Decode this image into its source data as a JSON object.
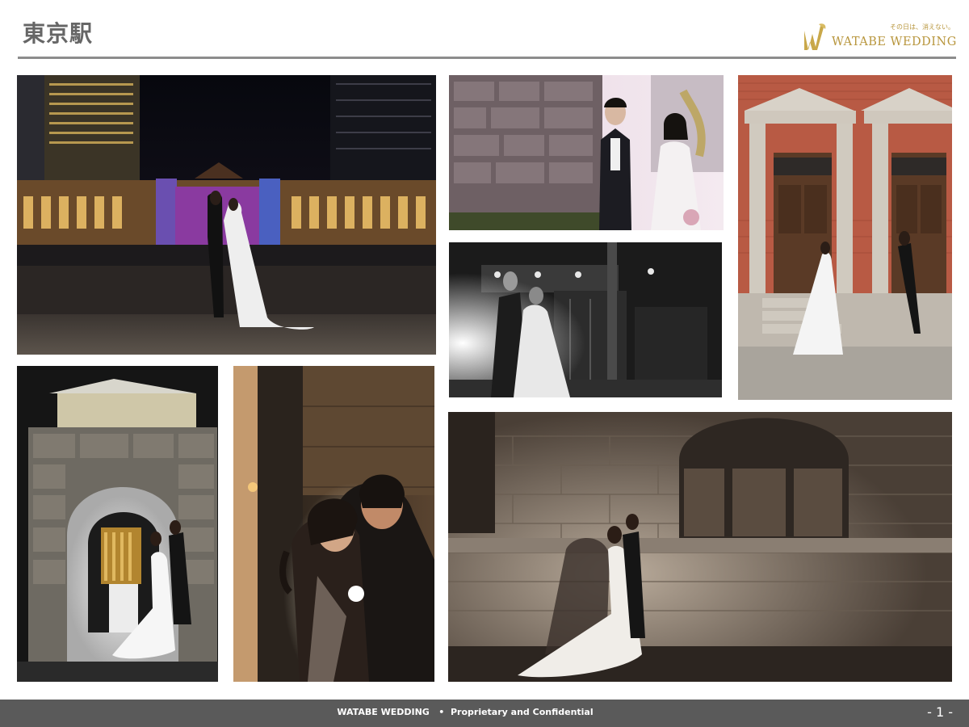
{
  "header": {
    "title": "東京駅",
    "logo": {
      "tagline": "その日は、消えない。",
      "name": "WATABE WEDDING"
    }
  },
  "photos": [
    {
      "id": "station-night-couple",
      "icon": "photo-icon"
    },
    {
      "id": "stone-wall-couple",
      "icon": "photo-icon"
    },
    {
      "id": "doorway-couple",
      "icon": "photo-icon"
    },
    {
      "id": "bw-entrance-couple",
      "icon": "photo-icon"
    },
    {
      "id": "gate-night-couple",
      "icon": "photo-icon"
    },
    {
      "id": "embrace-closeup",
      "icon": "photo-icon"
    },
    {
      "id": "wall-shadow-couple",
      "icon": "photo-icon"
    }
  ],
  "footer": {
    "text": "WATABE WEDDING   •  Proprietary and Confidential",
    "page_number": "- 1 -"
  },
  "colors": {
    "title": "#666666",
    "rule": "#8c8c8c",
    "brand_gold": "#b8963d",
    "footer_bg": "#5a5a5a"
  }
}
